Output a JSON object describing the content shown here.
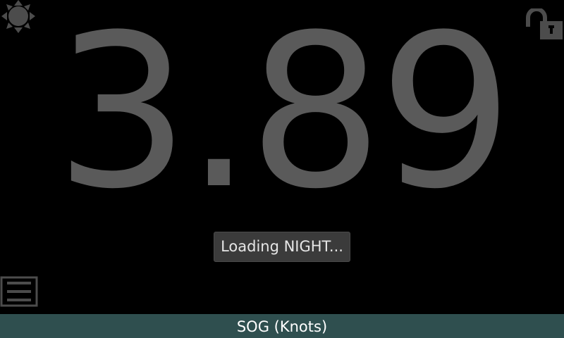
{
  "colors": {
    "background": "#000000",
    "readout": "#5a5a5a",
    "icon": "#4c4c4c",
    "bottom_bar": "#2f4f4f"
  },
  "icons": {
    "day_night": "sun-icon",
    "lock": "unlocked-padlock-icon",
    "menu": "hamburger-menu-icon"
  },
  "readout": {
    "value": "3.89"
  },
  "toast": {
    "text": "Loading NIGHT..."
  },
  "bottom_bar": {
    "label": "SOG (Knots)"
  }
}
